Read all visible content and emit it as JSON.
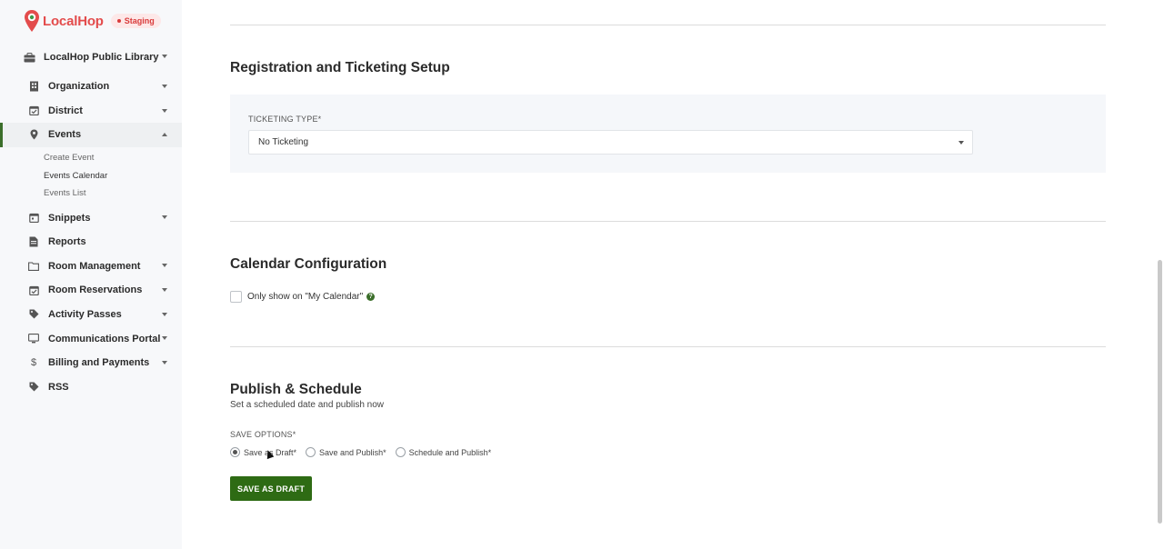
{
  "brand": {
    "logo_part1": "Local",
    "logo_part2": "Hop",
    "env_badge": "Staging",
    "brand_color": "#e34c4c"
  },
  "sidebar": {
    "org_name": "LocalHop Public Library",
    "items": [
      {
        "label": "Organization",
        "icon": "building-icon",
        "has_caret": true
      },
      {
        "label": "District",
        "icon": "calendar-check-icon",
        "has_caret": true
      },
      {
        "label": "Events",
        "icon": "map-pin-icon",
        "has_caret": true,
        "active": true
      },
      {
        "label": "Snippets",
        "icon": "calendar-icon",
        "has_caret": true
      },
      {
        "label": "Reports",
        "icon": "document-icon",
        "has_caret": false
      },
      {
        "label": "Room Management",
        "icon": "folder-icon",
        "has_caret": true
      },
      {
        "label": "Room Reservations",
        "icon": "calendar-check-icon",
        "has_caret": true
      },
      {
        "label": "Activity Passes",
        "icon": "tag-icon",
        "has_caret": true
      },
      {
        "label": "Communications Portal",
        "icon": "monitor-icon",
        "has_caret": true
      },
      {
        "label": "Billing and Payments",
        "icon": "dollar-icon",
        "has_caret": true
      },
      {
        "label": "RSS",
        "icon": "tag-icon",
        "has_caret": false
      }
    ],
    "events_subitems": [
      "Create Event",
      "Events Calendar",
      "Events List"
    ]
  },
  "registration": {
    "title": "Registration and Ticketing Setup",
    "ticketing_label": "TICKETING TYPE*",
    "ticketing_value": "No Ticketing"
  },
  "calendar": {
    "title": "Calendar Configuration",
    "checkbox_label": "Only show on \"My Calendar\"",
    "help_glyph": "?"
  },
  "publish": {
    "title": "Publish & Schedule",
    "subtitle": "Set a scheduled date and publish now",
    "save_options_label": "SAVE OPTIONS*",
    "options": [
      "Save as Draft*",
      "Save and Publish*",
      "Schedule and Publish*"
    ],
    "selected_index": 0,
    "button_label": "SAVE AS DRAFT",
    "button_color": "#2e6b14"
  }
}
